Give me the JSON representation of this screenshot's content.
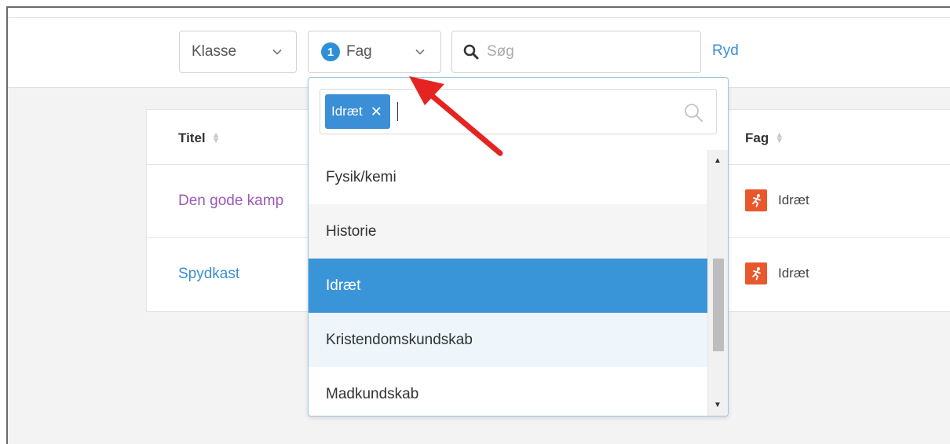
{
  "toolbar": {
    "klasse_label": "Klasse",
    "fag_label": "Fag",
    "fag_count": "1",
    "search_placeholder": "Søg",
    "clear_label": "Ryd"
  },
  "table": {
    "columns": {
      "title": "Titel",
      "subject": "Fag"
    },
    "rows": [
      {
        "title": "Den gode kamp",
        "subject": "Idræt",
        "title_color": "#9b59b6"
      },
      {
        "title": "Spydkast",
        "subject": "Idræt",
        "title_color": "#3a8fd1"
      }
    ]
  },
  "dropdown": {
    "selected_tag": "Idræt",
    "options": [
      {
        "label": "Fysik/kemi"
      },
      {
        "label": "Historie"
      },
      {
        "label": "Idræt"
      },
      {
        "label": "Kristendomskundskab"
      },
      {
        "label": "Madkundskab"
      }
    ],
    "selected_option": "Idræt"
  },
  "colors": {
    "accent": "#3a95d8",
    "annotation_arrow": "#e52421",
    "subject_icon": "#e8582c"
  },
  "icons": {
    "sport_icon": "running-person-icon",
    "search_icon": "magnifier-icon"
  }
}
